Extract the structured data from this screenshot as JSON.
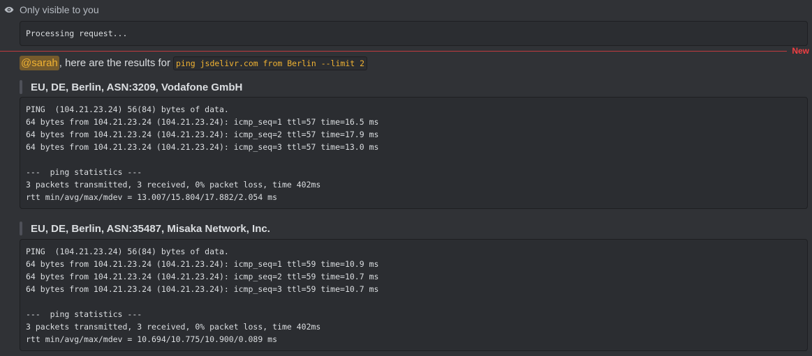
{
  "ephemeral": {
    "icon": "eye-icon",
    "text": "Only visible to you"
  },
  "processing": {
    "text": "Processing request..."
  },
  "divider": {
    "new_label": "New"
  },
  "result": {
    "mention": "@sarah",
    "text": ", here are the results for",
    "command": "ping jsdelivr.com from Berlin --limit 2"
  },
  "probes": [
    {
      "heading": "EU, DE, Berlin, ASN:3209, Vodafone GmbH",
      "lines": [
        "PING  (104.21.23.24) 56(84) bytes of data.",
        "64 bytes from 104.21.23.24 (104.21.23.24): icmp_seq=1 ttl=57 time=16.5 ms",
        "64 bytes from 104.21.23.24 (104.21.23.24): icmp_seq=2 ttl=57 time=17.9 ms",
        "64 bytes from 104.21.23.24 (104.21.23.24): icmp_seq=3 ttl=57 time=13.0 ms",
        "",
        "---  ping statistics ---",
        "3 packets transmitted, 3 received, 0% packet loss, time 402ms",
        "rtt min/avg/max/mdev = 13.007/15.804/17.882/2.054 ms"
      ]
    },
    {
      "heading": "EU, DE, Berlin, ASN:35487, Misaka Network, Inc.",
      "lines": [
        "PING  (104.21.23.24) 56(84) bytes of data.",
        "64 bytes from 104.21.23.24 (104.21.23.24): icmp_seq=1 ttl=59 time=10.9 ms",
        "64 bytes from 104.21.23.24 (104.21.23.24): icmp_seq=2 ttl=59 time=10.7 ms",
        "64 bytes from 104.21.23.24 (104.21.23.24): icmp_seq=3 ttl=59 time=10.7 ms",
        "",
        "---  ping statistics ---",
        "3 packets transmitted, 3 received, 0% packet loss, time 402ms",
        "rtt min/avg/max/mdev = 10.694/10.775/10.900/0.089 ms"
      ]
    }
  ],
  "colors": {
    "background": "#303236",
    "code_background": "#2b2d31",
    "mention": "#f0b232",
    "new_divider": "#f23f43"
  }
}
